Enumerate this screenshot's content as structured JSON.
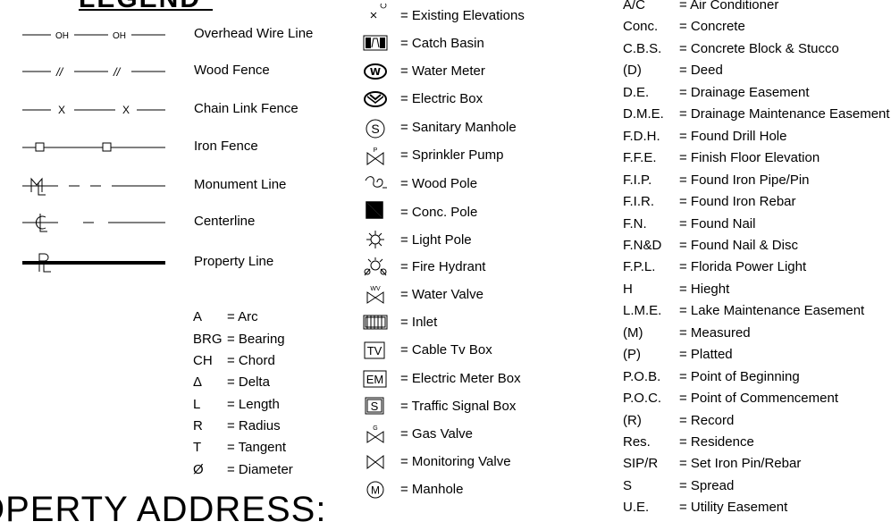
{
  "legend": {
    "title": "LEGEND"
  },
  "lines": [
    {
      "label": "Overhead Wire Line",
      "sample_text": "OH"
    },
    {
      "label": "Wood Fence",
      "sample_text": "//"
    },
    {
      "label": "Chain Link Fence",
      "sample_text": "X"
    },
    {
      "label": "Iron Fence",
      "sample_text": ""
    },
    {
      "label": "Monument Line",
      "sample_text": ""
    },
    {
      "label": "Centerline",
      "sample_text": ""
    },
    {
      "label": "Property Line",
      "sample_text": ""
    }
  ],
  "curve_abbr": [
    {
      "k": "A",
      "v": "= Arc"
    },
    {
      "k": "BRG",
      "v": "= Bearing"
    },
    {
      "k": "CH",
      "v": "= Chord"
    },
    {
      "k": "Δ",
      "v": "= Delta"
    },
    {
      "k": "L",
      "v": "= Length"
    },
    {
      "k": "R",
      "v": "= Radius"
    },
    {
      "k": "T",
      "v": "= Tangent"
    },
    {
      "k": "Ø",
      "v": "= Diameter"
    }
  ],
  "symbols": [
    {
      "icon": "existing-elevation-icon",
      "label": "= Existing Elevations"
    },
    {
      "icon": "catch-basin-icon",
      "label": "= Catch Basin"
    },
    {
      "icon": "water-meter-icon",
      "label": "= Water Meter",
      "glyph": "W"
    },
    {
      "icon": "electric-box-icon",
      "label": "= Electric Box"
    },
    {
      "icon": "sanitary-manhole-icon",
      "label": "= Sanitary Manhole",
      "glyph": "S"
    },
    {
      "icon": "sprinkler-pump-icon",
      "label": "= Sprinkler Pump",
      "glyph": "P"
    },
    {
      "icon": "wood-pole-icon",
      "label": "= Wood Pole"
    },
    {
      "icon": "conc-pole-icon",
      "label": "= Conc. Pole"
    },
    {
      "icon": "light-pole-icon",
      "label": "= Light Pole"
    },
    {
      "icon": "fire-hydrant-icon",
      "label": "= Fire Hydrant"
    },
    {
      "icon": "water-valve-icon",
      "label": "= Water Valve",
      "glyph": "WV"
    },
    {
      "icon": "inlet-icon",
      "label": "= Inlet"
    },
    {
      "icon": "cable-tv-box-icon",
      "label": "= Cable Tv Box",
      "glyph": "TV"
    },
    {
      "icon": "electric-meter-box-icon",
      "label": "= Electric Meter Box",
      "glyph": "EM"
    },
    {
      "icon": "traffic-signal-box-icon",
      "label": "= Traffic Signal Box",
      "glyph": "S"
    },
    {
      "icon": "gas-valve-icon",
      "label": "= Gas Valve",
      "glyph": "G"
    },
    {
      "icon": "monitoring-valve-icon",
      "label": "= Monitoring Valve"
    },
    {
      "icon": "manhole-icon",
      "label": "= Manhole",
      "glyph": "M"
    }
  ],
  "abbreviations": [
    {
      "k": "A/C",
      "v": "= Air Conditioner"
    },
    {
      "k": "Conc.",
      "v": "= Concrete"
    },
    {
      "k": "C.B.S.",
      "v": "= Concrete Block & Stucco"
    },
    {
      "k": "(D)",
      "v": "= Deed"
    },
    {
      "k": "D.E.",
      "v": "= Drainage Easement"
    },
    {
      "k": "D.M.E.",
      "v": "= Drainage Maintenance Easement"
    },
    {
      "k": "F.D.H.",
      "v": "= Found Drill Hole"
    },
    {
      "k": "F.F.E.",
      "v": "= Finish Floor Elevation"
    },
    {
      "k": "F.I.P.",
      "v": "= Found Iron Pipe/Pin"
    },
    {
      "k": "F.I.R.",
      "v": "= Found Iron Rebar"
    },
    {
      "k": "F.N.",
      "v": "= Found Nail"
    },
    {
      "k": "F.N&D",
      "v": "= Found Nail & Disc"
    },
    {
      "k": "F.P.L.",
      "v": "= Florida Power Light"
    },
    {
      "k": "H",
      "v": "= Hieght"
    },
    {
      "k": "L.M.E.",
      "v": "= Lake Maintenance Easement"
    },
    {
      "k": "(M)",
      "v": "= Measured"
    },
    {
      "k": "(P)",
      "v": "= Platted"
    },
    {
      "k": "P.O.B.",
      "v": "= Point of Beginning"
    },
    {
      "k": "P.O.C.",
      "v": "= Point of Commencement"
    },
    {
      "k": "(R)",
      "v": "= Record"
    },
    {
      "k": "Res.",
      "v": "= Residence"
    },
    {
      "k": "SIP/R",
      "v": "= Set Iron Pin/Rebar"
    },
    {
      "k": "S",
      "v": "= Spread"
    },
    {
      "k": "U.E.",
      "v": "= Utility Easement"
    }
  ],
  "address": {
    "label": "OPERTY ADDRESS:"
  }
}
